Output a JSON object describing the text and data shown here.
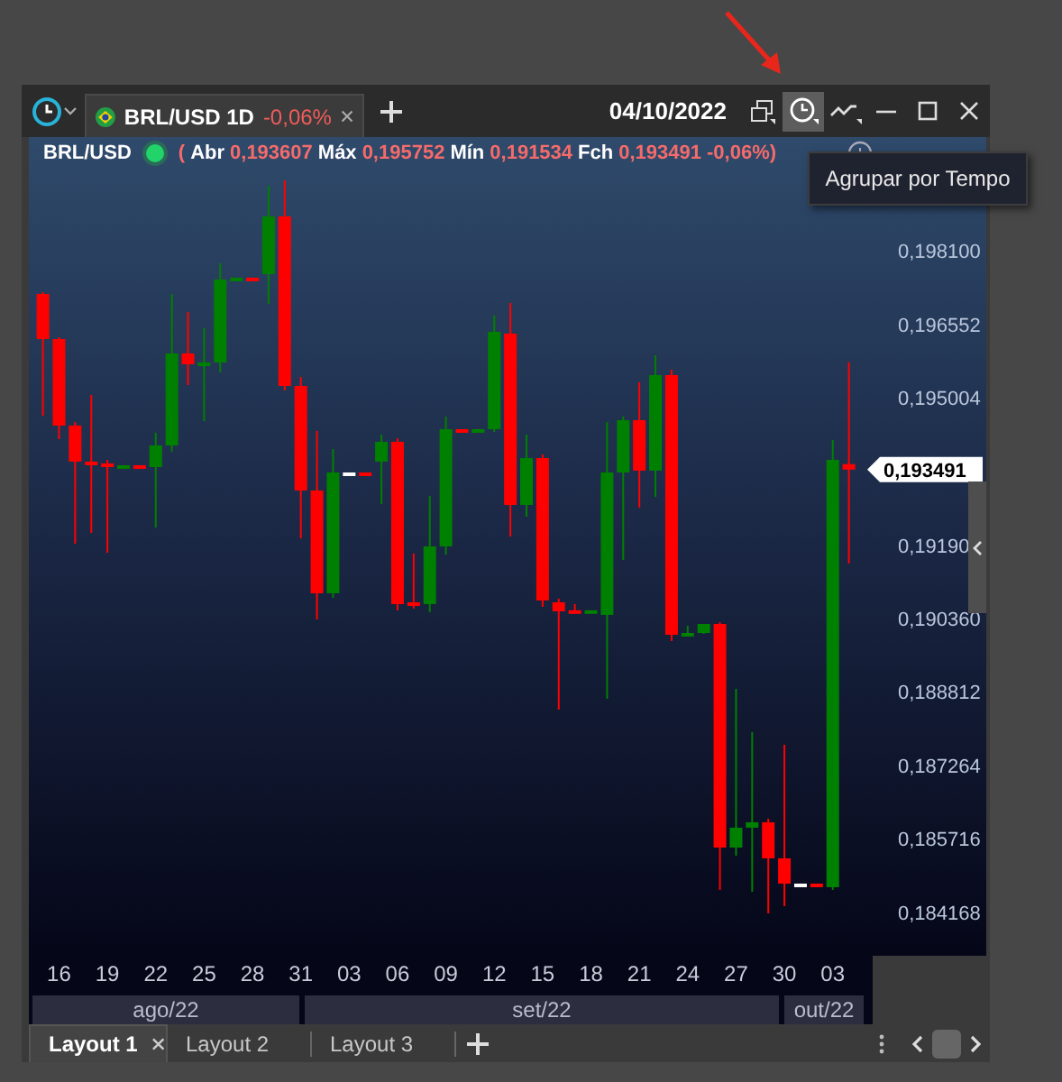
{
  "toolbar": {
    "tabs": [
      {
        "label": "BRL/USD 1D",
        "change": "-0,06%",
        "selected": true
      }
    ],
    "date": "04/10/2022",
    "tools": [
      {
        "kind": "windows",
        "selected": false
      },
      {
        "kind": "clock",
        "selected": true
      },
      {
        "kind": "trend",
        "selected": false
      }
    ]
  },
  "tooltip": {
    "text": "Agrupar por Tempo"
  },
  "legend": {
    "symbol": "BRL/USD",
    "open_paren": "(",
    "fields": [
      {
        "label": "Abr",
        "value": "0,193607"
      },
      {
        "label": "Máx",
        "value": "0,195752"
      },
      {
        "label": "Mín",
        "value": "0,191534"
      },
      {
        "label": "Fch",
        "value": "0,193491"
      }
    ],
    "change": "-0,06%)"
  },
  "last_price": "0,193491",
  "chart_data": {
    "type": "candlestick",
    "categories": [
      null,
      "16",
      null,
      null,
      "19",
      null,
      null,
      "22",
      null,
      null,
      "25",
      null,
      null,
      "28",
      null,
      null,
      "31",
      null,
      null,
      "03",
      null,
      null,
      "06",
      null,
      null,
      "09",
      null,
      null,
      "12",
      null,
      null,
      "15",
      null,
      null,
      "18",
      null,
      null,
      "21",
      null,
      null,
      "24",
      null,
      null,
      "27",
      null,
      null,
      "30",
      null,
      null,
      "03",
      null
    ],
    "ohlc": [
      [
        0.197189,
        0.197227,
        0.194646,
        0.19624
      ],
      [
        0.19624,
        0.196278,
        0.194152,
        0.194418
      ],
      [
        0.194418,
        0.194494,
        0.191951,
        0.193659
      ],
      [
        0.193659,
        0.195063,
        0.192178,
        0.193621
      ],
      [
        0.193621,
        0.193697,
        0.191761,
        0.193583
      ],
      [
        0.19356,
        0.193583,
        0.19352,
        0.193583
      ],
      [
        0.193583,
        0.193583,
        0.19356,
        0.19356
      ],
      [
        0.193545,
        0.194266,
        0.192292,
        0.194
      ],
      [
        0.194,
        0.197189,
        0.193886,
        0.195936
      ],
      [
        0.195936,
        0.196809,
        0.195291,
        0.195709
      ],
      [
        0.195709,
        0.196468,
        0.194532,
        0.195746
      ],
      [
        0.195746,
        0.197834,
        0.195557,
        0.197493
      ],
      [
        0.197493,
        0.197531,
        0.197493,
        0.197531
      ],
      [
        0.197531,
        0.197531,
        0.197493,
        0.197493
      ],
      [
        0.197607,
        0.199467,
        0.196999,
        0.198821
      ],
      [
        0.198821,
        0.19958,
        0.195177,
        0.195253
      ],
      [
        0.195253,
        0.195443,
        0.192064,
        0.193051
      ],
      [
        0.193051,
        0.194304,
        0.190356,
        0.190888
      ],
      [
        0.190888,
        0.193924,
        0.190812,
        0.193431
      ],
      [
        0.193431,
        0.193431,
        0.193431,
        0.193431
      ],
      [
        0.193431,
        0.193431,
        0.1934,
        0.1934
      ],
      [
        0.193659,
        0.194228,
        0.192786,
        0.194076
      ],
      [
        0.194076,
        0.194152,
        0.190546,
        0.19066
      ],
      [
        0.190698,
        0.191723,
        0.190584,
        0.19068
      ],
      [
        0.19066,
        0.192937,
        0.190508,
        0.191875
      ],
      [
        0.191875,
        0.194608,
        0.191723,
        0.194342
      ],
      [
        0.194342,
        0.194342,
        0.19432,
        0.19432
      ],
      [
        0.19432,
        0.194342,
        0.19432,
        0.194342
      ],
      [
        0.194342,
        0.196733,
        0.194304,
        0.196392
      ],
      [
        0.196354,
        0.196999,
        0.192102,
        0.192748
      ],
      [
        0.192748,
        0.194228,
        0.19252,
        0.193735
      ],
      [
        0.193735,
        0.19381,
        0.190622,
        0.190736
      ],
      [
        0.190698,
        0.190774,
        0.188458,
        0.190508
      ],
      [
        0.19053,
        0.19066,
        0.190508,
        0.190508
      ],
      [
        0.190508,
        0.19053,
        0.190508,
        0.19053
      ],
      [
        0.190432,
        0.194494,
        0.188686,
        0.193431
      ],
      [
        0.193431,
        0.194608,
        0.191609,
        0.194532
      ],
      [
        0.194532,
        0.195329,
        0.19271,
        0.193469
      ],
      [
        0.193469,
        0.195898,
        0.192937,
        0.195481
      ],
      [
        0.195481,
        0.195595,
        0.189901,
        0.190014
      ],
      [
        0.19003,
        0.190204,
        0.19003,
        0.190052
      ],
      [
        0.190052,
        0.190242,
        0.190052,
        0.190242
      ],
      [
        0.190242,
        0.19028,
        0.184662,
        0.185535
      ],
      [
        0.185535,
        0.188876,
        0.185384,
        0.185953
      ],
      [
        0.185953,
        0.187965,
        0.184624,
        0.186067
      ],
      [
        0.186067,
        0.186143,
        0.184168,
        0.185308
      ],
      [
        0.185308,
        0.187699,
        0.18432,
        0.184776
      ],
      [
        0.184776,
        0.184776,
        0.184776,
        0.184776
      ],
      [
        0.184776,
        0.184776,
        0.184738,
        0.184738
      ],
      [
        0.1847,
        0.194114,
        0.184662,
        0.193697
      ],
      [
        0.193607,
        0.195752,
        0.191534,
        0.193491
      ]
    ],
    "ylim": [
      0.184168,
      0.1981
    ],
    "yticks": [
      {
        "value": 0.1981,
        "label": "0,198100"
      },
      {
        "value": 0.196552,
        "label": "0,196552"
      },
      {
        "value": 0.195004,
        "label": "0,195004"
      },
      {
        "value": 0.1919,
        "label": "0,19190"
      },
      {
        "value": 0.19036,
        "label": "0,190360"
      },
      {
        "value": 0.188812,
        "label": "0,188812"
      },
      {
        "value": 0.187264,
        "label": "0,187264"
      },
      {
        "value": 0.185716,
        "label": "0,185716"
      },
      {
        "value": 0.184168,
        "label": "0,184168"
      }
    ]
  },
  "months": [
    "ago/22",
    "set/22",
    "out/22"
  ],
  "layouts": [
    {
      "label": "Layout 1",
      "selected": true
    },
    {
      "label": "Layout 2",
      "selected": false
    },
    {
      "label": "Layout 3",
      "selected": false
    }
  ]
}
